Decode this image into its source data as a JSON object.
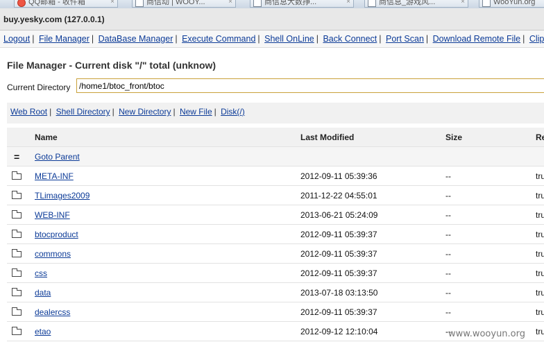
{
  "browser": {
    "tabs": [
      {
        "title": "QQ邮箱 - 收件箱",
        "icon": "qq-mail-icon"
      },
      {
        "title": "商信动 | WOOY...",
        "icon": "page-icon"
      },
      {
        "title": "商信息大数挣...",
        "icon": "page-icon"
      },
      {
        "title": "商信息_游戏风...",
        "icon": "page-icon"
      },
      {
        "title": "WooYun.org",
        "icon": "page-icon"
      }
    ],
    "title": "buy.yesky.com (127.0.0.1)"
  },
  "menu": {
    "items": [
      "Logout",
      "File Manager",
      "DataBase Manager",
      "Execute Command",
      "Shell OnLine",
      "Back Connect",
      "Port Scan",
      "Download Remote File",
      "ClipBoard"
    ],
    "separator": "|"
  },
  "file_manager": {
    "title": "File Manager - Current disk \"/\" total (unknow)",
    "current_dir_label": "Current Directory",
    "current_dir_value": "/home1/btoc_front/btoc",
    "actions": [
      "Web Root",
      "Shell Directory",
      "New Directory",
      "New File",
      "Disk(/)"
    ],
    "columns": {
      "name": "Name",
      "modified": "Last Modified",
      "size": "Size",
      "re": "Re"
    },
    "parent": {
      "icon": "=",
      "label": "Goto Parent"
    },
    "rows": [
      {
        "name": "META-INF",
        "modified": "2012-09-11 05:39:36",
        "size": "--",
        "re": "tru"
      },
      {
        "name": "TLimages2009",
        "modified": "2011-12-22 04:55:01",
        "size": "--",
        "re": "tru"
      },
      {
        "name": "WEB-INF",
        "modified": "2013-06-21 05:24:09",
        "size": "--",
        "re": "tru"
      },
      {
        "name": "btocproduct",
        "modified": "2012-09-11 05:39:37",
        "size": "--",
        "re": "tru"
      },
      {
        "name": "commons",
        "modified": "2012-09-11 05:39:37",
        "size": "--",
        "re": "tru"
      },
      {
        "name": "css",
        "modified": "2012-09-11 05:39:37",
        "size": "--",
        "re": "tru"
      },
      {
        "name": "data",
        "modified": "2013-07-18 03:13:50",
        "size": "--",
        "re": "tru"
      },
      {
        "name": "dealercss",
        "modified": "2012-09-11 05:39:37",
        "size": "--",
        "re": "tru"
      },
      {
        "name": "etao",
        "modified": "2012-09-12 12:10:04",
        "size": "--",
        "re": "tru"
      }
    ]
  },
  "watermark": "www.wooyun.org"
}
